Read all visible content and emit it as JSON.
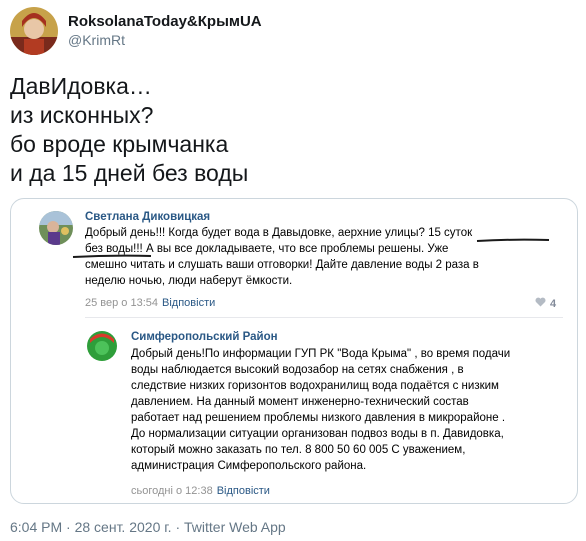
{
  "author": {
    "display_name": "RoksolanaToday&КрымUA",
    "handle": "@KrimRt"
  },
  "tweet": {
    "lines": [
      "ДавИдовка…",
      "из исконных?",
      "бо вроде крымчанка",
      "и да 15 дней без воды"
    ]
  },
  "screenshot": {
    "comment": {
      "author": "Светлана Диковицкая",
      "lines": [
        "Добрый день!!! Когда будет вода в Давыдовке, аерхние улицы? 15 суток",
        "без воды!!! А вы все докладываете, что все проблемы решены. Уже",
        "смешно читать и слушать ваши отговорки! Дайте давление воды 2 раза в",
        "неделю ночью, люди наберут ёмкости."
      ],
      "date": "25 вер о 13:54",
      "reply_label": "Відповісти",
      "likes": "4"
    },
    "reply": {
      "author": "Симферопольский Район",
      "lines": [
        "Добрый день!По информации ГУП РК \"Вода Крыма\" , во время подачи",
        "воды наблюдается высокий водозабор на сетях снабжения , в",
        "следствие низких горизонтов водохранилищ вода подаётся с низким",
        "давлением. На данный момент инженерно-технический состав",
        "работает над решением проблемы низкого давления в микрорайоне .",
        "До нормализации ситуации организован подвоз воды в п. Давидовка,",
        "который можно заказать по тел. 8 800 50 60 005 С уважением,",
        "администрация Симферопольского района."
      ],
      "date": "сьогодні о 12:38",
      "reply_label": "Відповісти"
    }
  },
  "footer": {
    "time": "6:04 PM",
    "date": "28 сент. 2020 г.",
    "separator": "·",
    "source": "Twitter Web App"
  },
  "colors": {
    "vk_link": "#2a5885",
    "twitter_gray": "#657786",
    "underline": "#1a1a1a"
  }
}
